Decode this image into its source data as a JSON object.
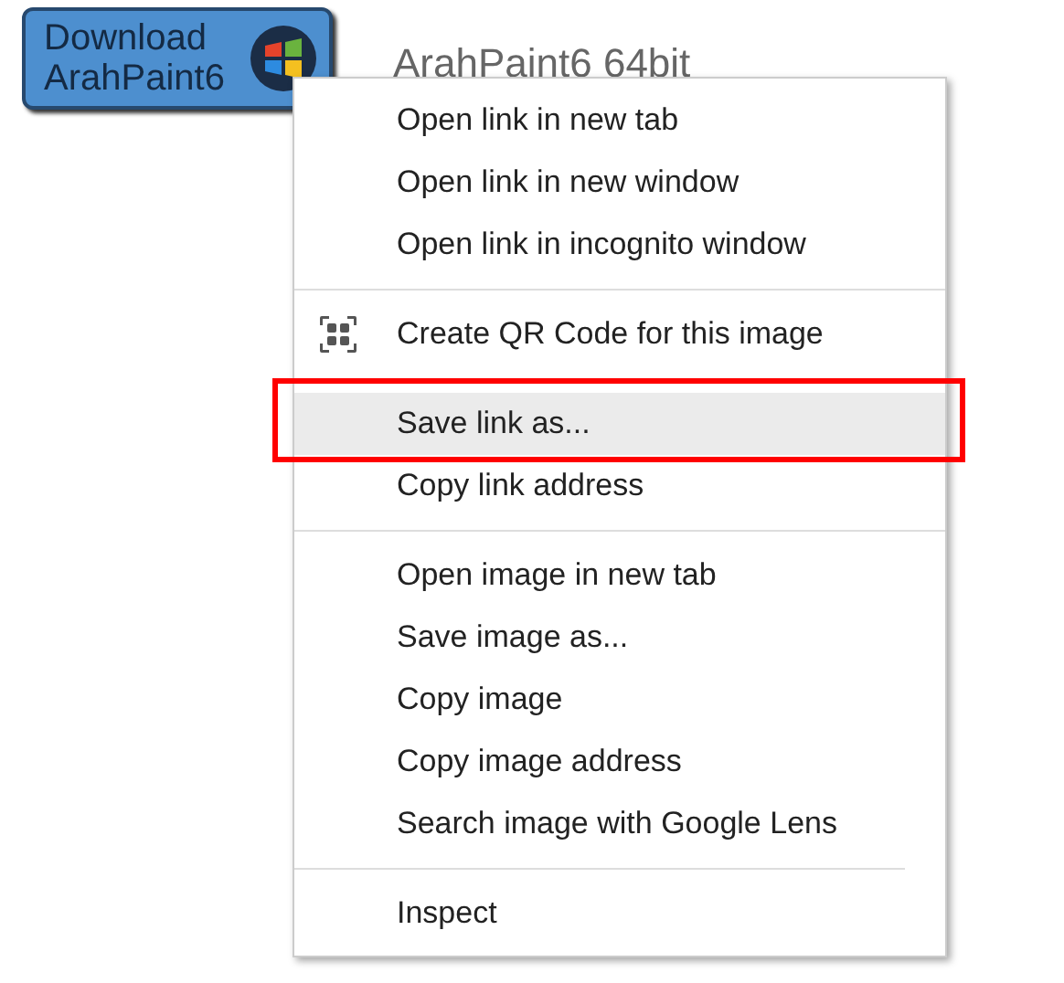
{
  "download_button": {
    "line_1": "Download",
    "line_2": "ArahPaint6"
  },
  "page_title": "ArahPaint6 64bit",
  "context_menu": {
    "groups": [
      {
        "items": [
          {
            "label": "Open link in new tab",
            "selected": false
          },
          {
            "label": "Open link in new window",
            "selected": false
          },
          {
            "label": "Open link in incognito window",
            "selected": false
          }
        ]
      },
      {
        "items": [
          {
            "label": "Create QR Code for this image",
            "selected": false,
            "kind": "qr"
          }
        ]
      },
      {
        "items": [
          {
            "label": "Save link as...",
            "selected": true
          },
          {
            "label": "Copy link address",
            "selected": false
          }
        ]
      },
      {
        "items": [
          {
            "label": "Open image in new tab",
            "selected": false
          },
          {
            "label": "Save image as...",
            "selected": false
          },
          {
            "label": "Copy image",
            "selected": false
          },
          {
            "label": "Copy image address",
            "selected": false
          },
          {
            "label": "Search image with Google Lens",
            "selected": false
          }
        ]
      },
      {
        "items": [
          {
            "label": "Inspect",
            "selected": false
          }
        ]
      }
    ]
  }
}
